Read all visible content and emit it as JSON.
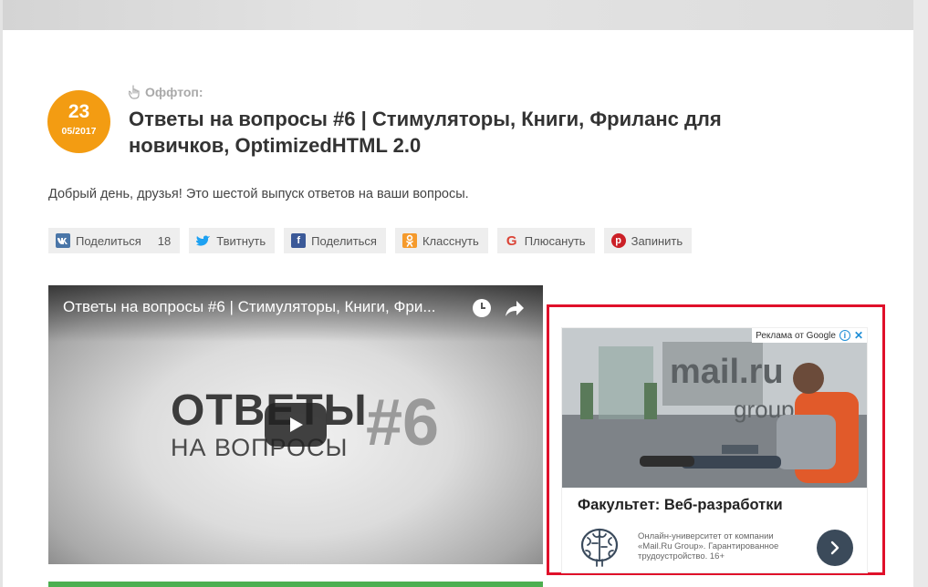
{
  "post": {
    "date_day": "23",
    "date_month": "05/2017",
    "category": "Оффтоп:",
    "title": "Ответы на вопросы #6 | Стимуляторы, Книги, Фриланс для новичков, OptimizedHTML 2.0",
    "intro": "Добрый день, друзья! Это шестой выпуск ответов на ваши вопросы."
  },
  "share": {
    "buttons": [
      {
        "label": "Поделиться",
        "icon": "vk-icon",
        "color": "#4a76a8",
        "count": "18"
      },
      {
        "label": "Твитнуть",
        "icon": "twitter-icon",
        "color": "#1da1f2"
      },
      {
        "label": "Поделиться",
        "icon": "facebook-icon",
        "color": "#3b5998"
      },
      {
        "label": "Класснуть",
        "icon": "odnoklassniki-icon",
        "color": "#f59a2c"
      },
      {
        "label": "Плюсануть",
        "icon": "google-plus-icon",
        "color": "#db4437"
      },
      {
        "label": "Запинить",
        "icon": "pinterest-icon",
        "color": "#cb2027"
      }
    ]
  },
  "video": {
    "title": "Ответы на вопросы #6 | Стимуляторы, Книги, Фри...",
    "thumb_word": "ОТВЕТЫ",
    "thumb_sub": "НА ВОПРОСЫ",
    "thumb_num": "#6"
  },
  "ad": {
    "label": "Реклама от Google",
    "headline": "Факультет: Веб-разработки",
    "description": "Онлайн-университет от компании «Mail.Ru Group». Гарантированное трудоустройство. 16+",
    "highlight_color": "#e0102a"
  },
  "colors": {
    "accent": "#f39c12",
    "progress": "#4caf50"
  }
}
